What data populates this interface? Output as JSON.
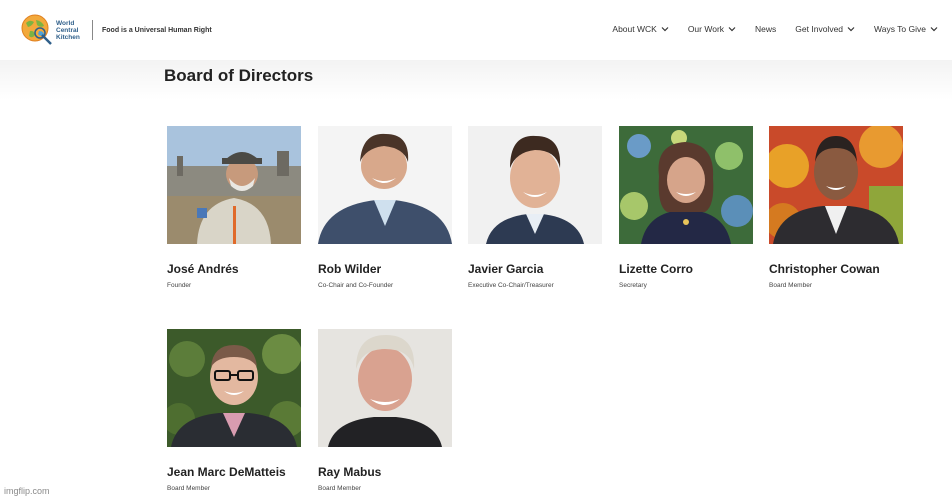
{
  "header": {
    "logo_words": [
      "World",
      "Central",
      "Kitchen"
    ],
    "tagline": "Food is a Universal Human Right",
    "nav": [
      {
        "label": "About WCK",
        "dropdown": true
      },
      {
        "label": "Our Work",
        "dropdown": true
      },
      {
        "label": "News",
        "dropdown": false
      },
      {
        "label": "Get Involved",
        "dropdown": true
      },
      {
        "label": "Ways To Give",
        "dropdown": true
      }
    ]
  },
  "page": {
    "title": "Board of Directors"
  },
  "directors": [
    {
      "name": "José Andrés",
      "role": "Founder"
    },
    {
      "name": "Rob Wilder",
      "role": "Co-Chair and Co-Founder"
    },
    {
      "name": "Javier Garcia",
      "role": "Executive Co-Chair/Treasurer"
    },
    {
      "name": "Lizette Corro",
      "role": "Secretary"
    },
    {
      "name": "Christopher Cowan",
      "role": "Board Member"
    },
    {
      "name": "Jean Marc DeMatteis",
      "role": "Board Member"
    },
    {
      "name": "Ray Mabus",
      "role": "Board Member"
    }
  ],
  "watermark": "imgflip.com",
  "colors": {
    "brand_blue": "#2f5f8a",
    "logo_orange": "#f2a93b",
    "text": "#222222"
  }
}
